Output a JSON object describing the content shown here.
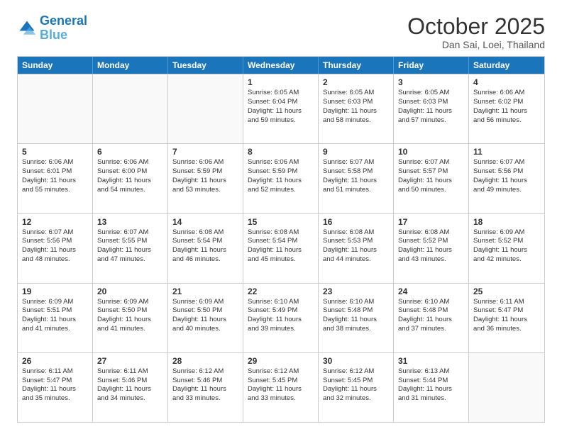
{
  "logo": {
    "line1": "General",
    "line2": "Blue"
  },
  "header": {
    "month": "October 2025",
    "location": "Dan Sai, Loei, Thailand"
  },
  "days": [
    "Sunday",
    "Monday",
    "Tuesday",
    "Wednesday",
    "Thursday",
    "Friday",
    "Saturday"
  ],
  "weeks": [
    [
      {
        "day": "",
        "lines": []
      },
      {
        "day": "",
        "lines": []
      },
      {
        "day": "",
        "lines": []
      },
      {
        "day": "1",
        "lines": [
          "Sunrise: 6:05 AM",
          "Sunset: 6:04 PM",
          "Daylight: 11 hours",
          "and 59 minutes."
        ]
      },
      {
        "day": "2",
        "lines": [
          "Sunrise: 6:05 AM",
          "Sunset: 6:03 PM",
          "Daylight: 11 hours",
          "and 58 minutes."
        ]
      },
      {
        "day": "3",
        "lines": [
          "Sunrise: 6:05 AM",
          "Sunset: 6:03 PM",
          "Daylight: 11 hours",
          "and 57 minutes."
        ]
      },
      {
        "day": "4",
        "lines": [
          "Sunrise: 6:06 AM",
          "Sunset: 6:02 PM",
          "Daylight: 11 hours",
          "and 56 minutes."
        ]
      }
    ],
    [
      {
        "day": "5",
        "lines": [
          "Sunrise: 6:06 AM",
          "Sunset: 6:01 PM",
          "Daylight: 11 hours",
          "and 55 minutes."
        ]
      },
      {
        "day": "6",
        "lines": [
          "Sunrise: 6:06 AM",
          "Sunset: 6:00 PM",
          "Daylight: 11 hours",
          "and 54 minutes."
        ]
      },
      {
        "day": "7",
        "lines": [
          "Sunrise: 6:06 AM",
          "Sunset: 5:59 PM",
          "Daylight: 11 hours",
          "and 53 minutes."
        ]
      },
      {
        "day": "8",
        "lines": [
          "Sunrise: 6:06 AM",
          "Sunset: 5:59 PM",
          "Daylight: 11 hours",
          "and 52 minutes."
        ]
      },
      {
        "day": "9",
        "lines": [
          "Sunrise: 6:07 AM",
          "Sunset: 5:58 PM",
          "Daylight: 11 hours",
          "and 51 minutes."
        ]
      },
      {
        "day": "10",
        "lines": [
          "Sunrise: 6:07 AM",
          "Sunset: 5:57 PM",
          "Daylight: 11 hours",
          "and 50 minutes."
        ]
      },
      {
        "day": "11",
        "lines": [
          "Sunrise: 6:07 AM",
          "Sunset: 5:56 PM",
          "Daylight: 11 hours",
          "and 49 minutes."
        ]
      }
    ],
    [
      {
        "day": "12",
        "lines": [
          "Sunrise: 6:07 AM",
          "Sunset: 5:56 PM",
          "Daylight: 11 hours",
          "and 48 minutes."
        ]
      },
      {
        "day": "13",
        "lines": [
          "Sunrise: 6:07 AM",
          "Sunset: 5:55 PM",
          "Daylight: 11 hours",
          "and 47 minutes."
        ]
      },
      {
        "day": "14",
        "lines": [
          "Sunrise: 6:08 AM",
          "Sunset: 5:54 PM",
          "Daylight: 11 hours",
          "and 46 minutes."
        ]
      },
      {
        "day": "15",
        "lines": [
          "Sunrise: 6:08 AM",
          "Sunset: 5:54 PM",
          "Daylight: 11 hours",
          "and 45 minutes."
        ]
      },
      {
        "day": "16",
        "lines": [
          "Sunrise: 6:08 AM",
          "Sunset: 5:53 PM",
          "Daylight: 11 hours",
          "and 44 minutes."
        ]
      },
      {
        "day": "17",
        "lines": [
          "Sunrise: 6:08 AM",
          "Sunset: 5:52 PM",
          "Daylight: 11 hours",
          "and 43 minutes."
        ]
      },
      {
        "day": "18",
        "lines": [
          "Sunrise: 6:09 AM",
          "Sunset: 5:52 PM",
          "Daylight: 11 hours",
          "and 42 minutes."
        ]
      }
    ],
    [
      {
        "day": "19",
        "lines": [
          "Sunrise: 6:09 AM",
          "Sunset: 5:51 PM",
          "Daylight: 11 hours",
          "and 41 minutes."
        ]
      },
      {
        "day": "20",
        "lines": [
          "Sunrise: 6:09 AM",
          "Sunset: 5:50 PM",
          "Daylight: 11 hours",
          "and 41 minutes."
        ]
      },
      {
        "day": "21",
        "lines": [
          "Sunrise: 6:09 AM",
          "Sunset: 5:50 PM",
          "Daylight: 11 hours",
          "and 40 minutes."
        ]
      },
      {
        "day": "22",
        "lines": [
          "Sunrise: 6:10 AM",
          "Sunset: 5:49 PM",
          "Daylight: 11 hours",
          "and 39 minutes."
        ]
      },
      {
        "day": "23",
        "lines": [
          "Sunrise: 6:10 AM",
          "Sunset: 5:48 PM",
          "Daylight: 11 hours",
          "and 38 minutes."
        ]
      },
      {
        "day": "24",
        "lines": [
          "Sunrise: 6:10 AM",
          "Sunset: 5:48 PM",
          "Daylight: 11 hours",
          "and 37 minutes."
        ]
      },
      {
        "day": "25",
        "lines": [
          "Sunrise: 6:11 AM",
          "Sunset: 5:47 PM",
          "Daylight: 11 hours",
          "and 36 minutes."
        ]
      }
    ],
    [
      {
        "day": "26",
        "lines": [
          "Sunrise: 6:11 AM",
          "Sunset: 5:47 PM",
          "Daylight: 11 hours",
          "and 35 minutes."
        ]
      },
      {
        "day": "27",
        "lines": [
          "Sunrise: 6:11 AM",
          "Sunset: 5:46 PM",
          "Daylight: 11 hours",
          "and 34 minutes."
        ]
      },
      {
        "day": "28",
        "lines": [
          "Sunrise: 6:12 AM",
          "Sunset: 5:46 PM",
          "Daylight: 11 hours",
          "and 33 minutes."
        ]
      },
      {
        "day": "29",
        "lines": [
          "Sunrise: 6:12 AM",
          "Sunset: 5:45 PM",
          "Daylight: 11 hours",
          "and 33 minutes."
        ]
      },
      {
        "day": "30",
        "lines": [
          "Sunrise: 6:12 AM",
          "Sunset: 5:45 PM",
          "Daylight: 11 hours",
          "and 32 minutes."
        ]
      },
      {
        "day": "31",
        "lines": [
          "Sunrise: 6:13 AM",
          "Sunset: 5:44 PM",
          "Daylight: 11 hours",
          "and 31 minutes."
        ]
      },
      {
        "day": "",
        "lines": []
      }
    ]
  ]
}
